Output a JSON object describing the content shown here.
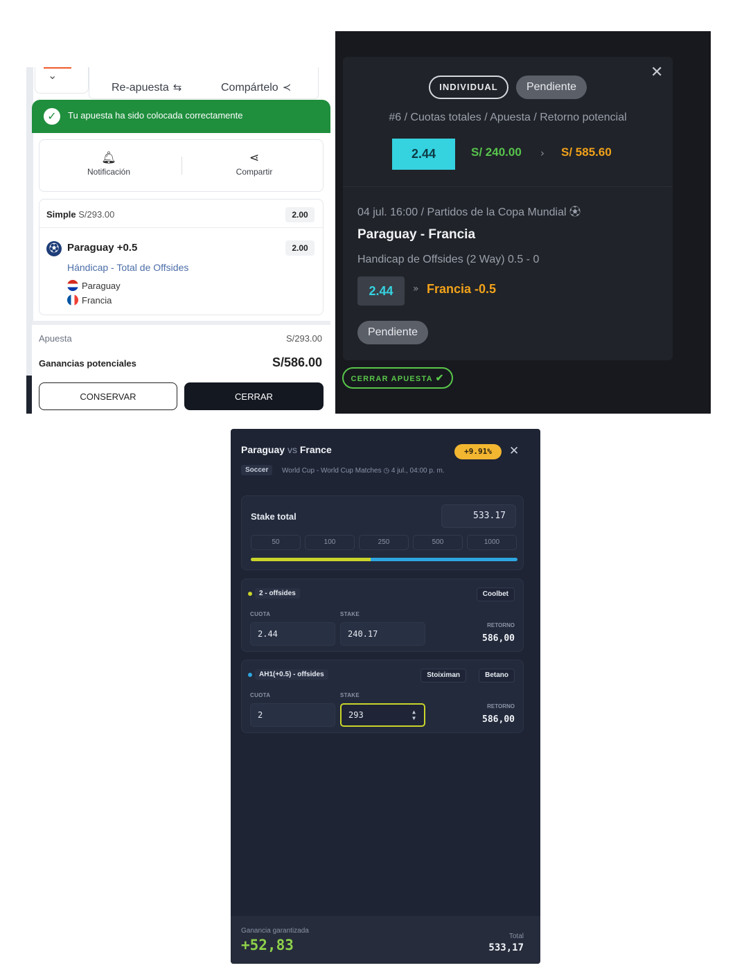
{
  "panel1": {
    "top_actions": {
      "rebet": "Re-apuesta",
      "share": "Compártelo"
    },
    "success_message": "Tu apuesta ha sido colocada correctamente",
    "notification_label": "Notificación",
    "share_label": "Compartir",
    "bet": {
      "type": "Simple",
      "amount": "S/293.00",
      "total_odds": "2.00",
      "selection": "Paraguay +0.5",
      "selection_odds": "2.00",
      "market": "Hándicap - Total de Offsides",
      "team_home": "Paraguay",
      "team_away": "Francia"
    },
    "stake_label": "Apuesta",
    "stake_value": "S/293.00",
    "potential_label": "Ganancias potenciales",
    "potential_value": "S/586.00",
    "keep_button": "CONSERVAR",
    "close_button": "CERRAR"
  },
  "panel2": {
    "badge_type": "INDIVIDUAL",
    "badge_status": "Pendiente",
    "summary": "#6 / Cuotas totales / Apuesta / Retorno potencial",
    "odds": "2.44",
    "stake": "S/ 240.00",
    "return": "S/ 585.60",
    "datetime": "04 jul. 16:00",
    "competition": "Partidos de la Copa Mundial",
    "match": "Paraguay - Francia",
    "market": "Handicap de Offsides (2 Way) 0.5 - 0",
    "pick_odds": "2.44",
    "pick": "Francia -0.5",
    "status": "Pendiente",
    "cashout_button": "CERRAR APUESTA"
  },
  "panel3": {
    "home": "Paraguay",
    "vs": "vs",
    "away": "France",
    "profit_pct": "+9.91%",
    "sport": "Soccer",
    "league": "World Cup - World Cup Matches",
    "date": "4 jul., 04:00 p. m.",
    "stake_total_label": "Stake total",
    "stake_total_value": "533.17",
    "chips": [
      "50",
      "100",
      "250",
      "500",
      "1000"
    ],
    "distribution_fraction": 0.45,
    "colors": {
      "leg1": "#c9d42a",
      "leg2": "#2ea6e0",
      "profit": "#8ed14a",
      "pct_badge": "#f2b630"
    },
    "legs": [
      {
        "label": "2 - offsides",
        "bookmakers": [
          "Coolbet"
        ],
        "odds_label": "CUOTA",
        "odds": "2.44",
        "stake_label": "STAKE",
        "stake": "240.17",
        "return_label": "RETORNO",
        "return": "586,00"
      },
      {
        "label": "AH1(+0.5) - offsides",
        "bookmakers": [
          "Stoiximan",
          "Betano"
        ],
        "odds_label": "CUOTA",
        "odds": "2",
        "stake_label": "STAKE",
        "stake": "293",
        "return_label": "RETORNO",
        "return": "586,00"
      }
    ],
    "guaranteed_label": "Ganancia garantizada",
    "guaranteed_value": "+52,83",
    "total_label": "Total",
    "total_value": "533,17"
  }
}
